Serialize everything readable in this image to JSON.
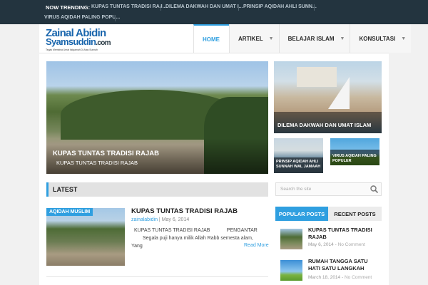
{
  "trending": {
    "label": "NOW TRENDING:",
    "items": [
      "KUPAS TUNTAS TRADISI RAJ...",
      "DILEMA DAKWAH DAN UMAT I...",
      "PRINSIP AQIDAH AHLI SUNN...",
      "VIRUS AQIDAH PALING POPU..."
    ]
  },
  "logo": {
    "line1": "Zainal Abidin",
    "line2_main": "Syamsuddin",
    "line2_suffix": ".com",
    "tagline": "Tegak Membina Umat Istiqamah Di Atas Sunnah"
  },
  "nav": {
    "items": [
      {
        "label": "HOME",
        "active": true
      },
      {
        "label": "ARTIKEL",
        "dropdown": true
      },
      {
        "label": "BELAJAR ISLAM",
        "dropdown": true
      },
      {
        "label": "KONSULTASI",
        "dropdown": true
      }
    ]
  },
  "featured": {
    "main": {
      "title": "KUPAS TUNTAS TRADISI RAJAB",
      "subtitle": "KUPAS TUNTAS TRADISI RAJAB"
    },
    "side_top": {
      "title": "DILEMA DAKWAH DAN UMAT ISLAM"
    },
    "small_1": {
      "title": "PRINSIP AQIDAH AHLI SUNNAH WAL JAMAAH"
    },
    "small_2": {
      "title": "VIRUS AQIDAH PALING POPULER"
    }
  },
  "latest": {
    "heading": "LATEST",
    "post": {
      "category": "AQIDAH MUSLIM",
      "title": "KUPAS TUNTAS TRADISI RAJAB",
      "author": "zainalabidin",
      "separator": " | ",
      "date": "May 6, 2014",
      "excerpt_line1": "KUPAS TUNTAS TRADISI RAJAB            PENGANTAR",
      "excerpt_line2": "Segala puji hanya milik Allah Rabb semesta alam,",
      "excerpt_line3": "Yang",
      "read_more": "Read More"
    }
  },
  "sidebar": {
    "search_placeholder": "Search the site",
    "tabs": [
      "POPULAR POSTS",
      "RECENT POSTS"
    ],
    "posts": [
      {
        "title": "KUPAS TUNTAS TRADISI RAJAB",
        "date": "May 6, 2014",
        "comments": "No Comment"
      },
      {
        "title": "RUMAH TANGGA SATU HATI SATU LANGKAH",
        "date": "March 18, 2014",
        "comments": "No Comment"
      }
    ],
    "meta_separator": " - "
  }
}
